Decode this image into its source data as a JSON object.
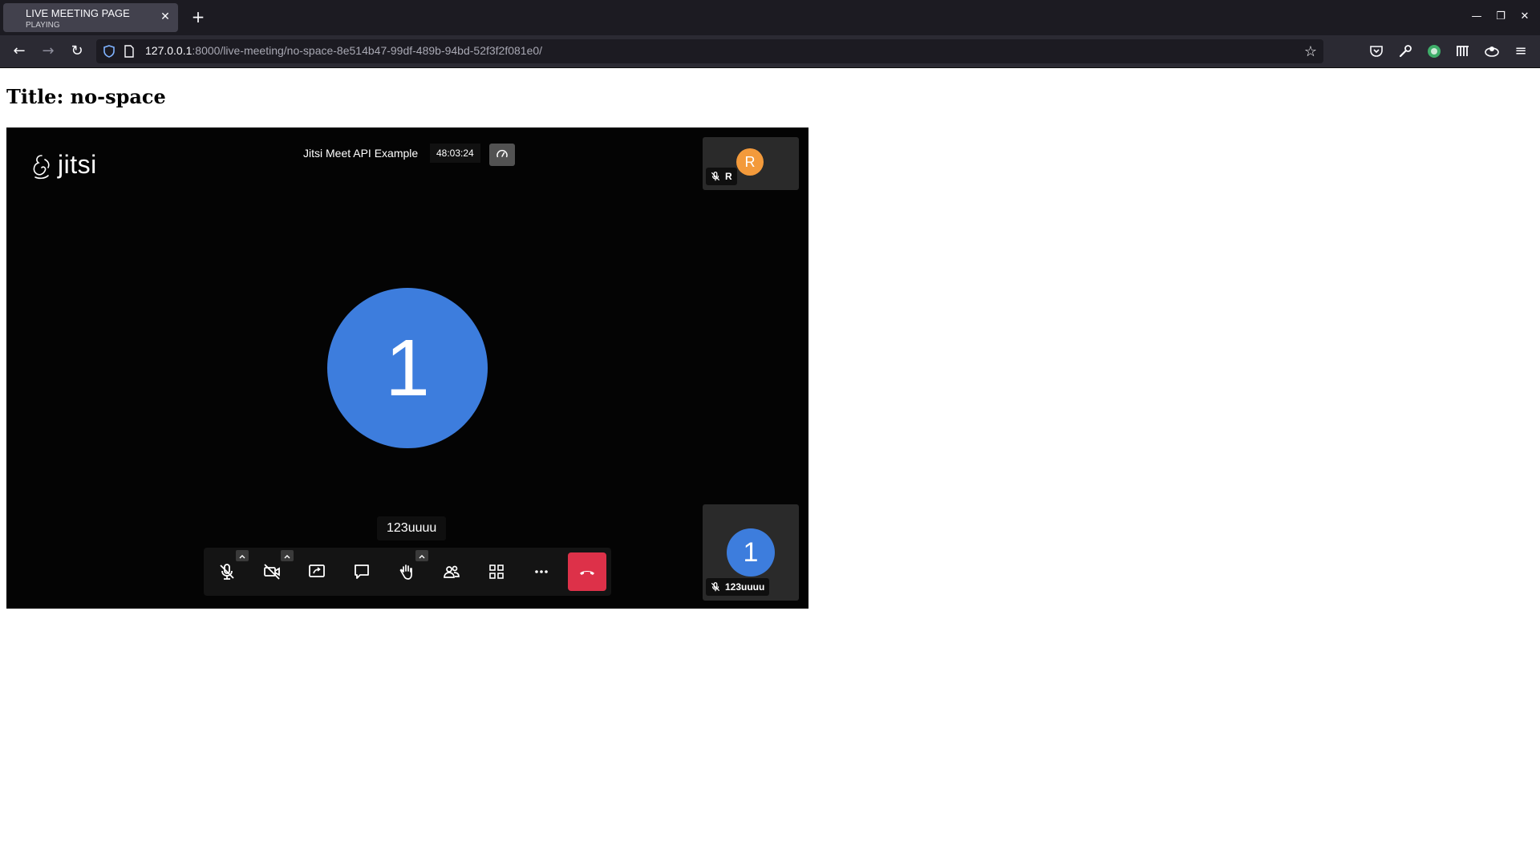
{
  "browser": {
    "tab": {
      "title": "LIVE MEETING PAGE",
      "subtitle": "PLAYING",
      "close_icon": "close-icon"
    },
    "new_tab": "+",
    "url": {
      "host": "127.0.0.1",
      "rest": ":8000/live-meeting/no-space-8e514b47-99df-489b-94bd-52f3f2f081e0/"
    }
  },
  "page": {
    "title": "Title: no-space"
  },
  "meeting": {
    "logo_text": "jitsi",
    "subject": "Jitsi Meet API Example",
    "timer": "48:03:24",
    "dominant": {
      "avatar_initial": "1",
      "name": "123uuuu",
      "avatar_color": "#3d7ddd"
    },
    "participants": [
      {
        "initial": "R",
        "label": "R",
        "avatar_color": "#f39a3b",
        "muted": true
      },
      {
        "initial": "1",
        "label": "123uuuu",
        "avatar_color": "#3d7ddd",
        "muted": true
      }
    ],
    "toolbar": [
      {
        "name": "microphone-toggle",
        "icon": "mic-off-icon",
        "has_menu": true
      },
      {
        "name": "camera-toggle",
        "icon": "camera-off-icon",
        "has_menu": true
      },
      {
        "name": "screen-share",
        "icon": "screen-share-icon",
        "has_menu": false
      },
      {
        "name": "chat",
        "icon": "chat-icon",
        "has_menu": false
      },
      {
        "name": "raise-hand",
        "icon": "hand-icon",
        "has_menu": true
      },
      {
        "name": "participants",
        "icon": "participants-icon",
        "has_menu": false
      },
      {
        "name": "tile-view",
        "icon": "grid-icon",
        "has_menu": false
      },
      {
        "name": "more-actions",
        "icon": "more-icon",
        "has_menu": false
      },
      {
        "name": "hangup",
        "icon": "hangup-icon",
        "color": "#dd3149"
      }
    ]
  }
}
